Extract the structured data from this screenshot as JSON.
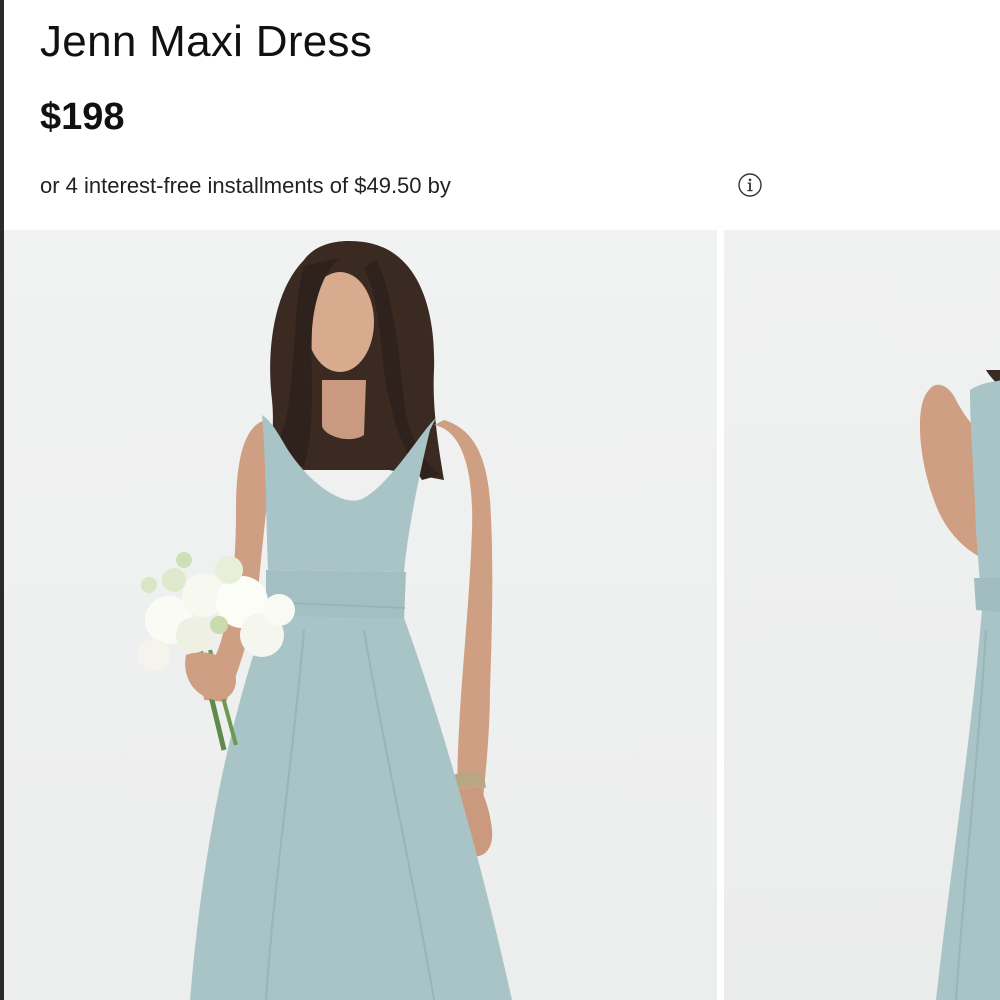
{
  "product": {
    "title": "Jenn Maxi Dress",
    "price": "$198",
    "installments_text": "or 4 interest-free installments of $49.50 by"
  },
  "icons": {
    "info": "info-icon"
  },
  "colors": {
    "dress": "#a9c4c6",
    "background": "#eef0f0",
    "text": "#111111"
  },
  "gallery": {
    "images": [
      {
        "name": "model-front-image"
      },
      {
        "name": "model-side-image"
      }
    ]
  }
}
